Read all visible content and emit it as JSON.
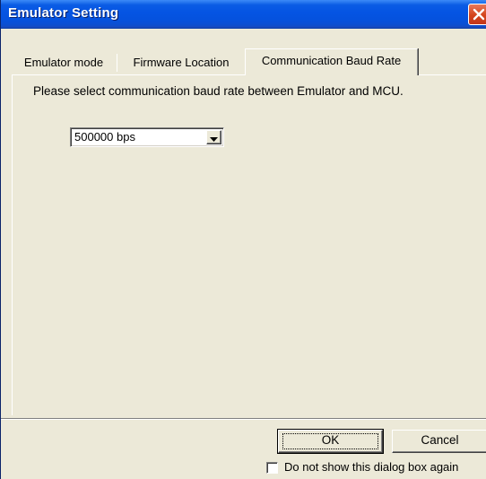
{
  "window": {
    "title": "Emulator Setting"
  },
  "tabs": [
    {
      "label": "Emulator mode",
      "active": false
    },
    {
      "label": "Firmware Location",
      "active": false
    },
    {
      "label": "Communication Baud Rate",
      "active": true
    }
  ],
  "panel": {
    "instruction": "Please select communication baud rate between Emulator and MCU.",
    "baud_rate": {
      "selected": "500000 bps"
    }
  },
  "footer": {
    "ok_label": "OK",
    "cancel_label": "Cancel",
    "checkbox_label": "Do not show this dialog box again",
    "checkbox_checked": false
  },
  "icons": {
    "close": "close-icon",
    "dropdown": "chevron-down-icon"
  },
  "colors": {
    "titlebar": "#0554e3",
    "close_button": "#d4441c",
    "dialog_background": "#ece9d8"
  }
}
